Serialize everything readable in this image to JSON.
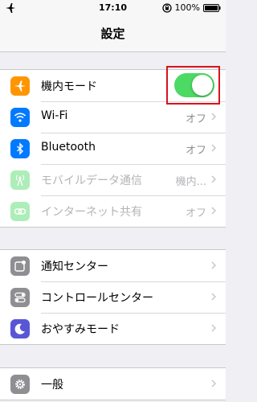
{
  "status_bar": {
    "time": "17:10",
    "battery": "100%"
  },
  "nav": {
    "title": "設定"
  },
  "groups": [
    {
      "rows": [
        {
          "label": "機内モード",
          "icon": "airplane-icon",
          "icon_color": "#ff9500",
          "toggle": true
        },
        {
          "label": "Wi-Fi",
          "value": "オフ",
          "icon": "wifi-icon",
          "icon_color": "#007aff"
        },
        {
          "label": "Bluetooth",
          "value": "オフ",
          "icon": "bluetooth-icon",
          "icon_color": "#007aff"
        },
        {
          "label": "モバイルデータ通信",
          "value": "機内...",
          "icon": "cellular-icon",
          "icon_color": "#4cd964",
          "disabled": true
        },
        {
          "label": "インターネット共有",
          "value": "オフ",
          "icon": "hotspot-icon",
          "icon_color": "#4cd964",
          "disabled": true
        }
      ]
    },
    {
      "rows": [
        {
          "label": "通知センター",
          "icon": "notification-center-icon",
          "icon_color": "#8e8e93"
        },
        {
          "label": "コントロールセンター",
          "icon": "control-center-icon",
          "icon_color": "#8e8e93"
        },
        {
          "label": "おやすみモード",
          "icon": "moon-icon",
          "icon_color": "#5856d6"
        }
      ]
    },
    {
      "rows": [
        {
          "label": "一般",
          "icon": "gear-icon",
          "icon_color": "#8e8e93"
        }
      ]
    }
  ],
  "colors": {
    "toggle_on": "#4cd964",
    "highlight_box": "#d7131a",
    "background": "#efeff4"
  }
}
